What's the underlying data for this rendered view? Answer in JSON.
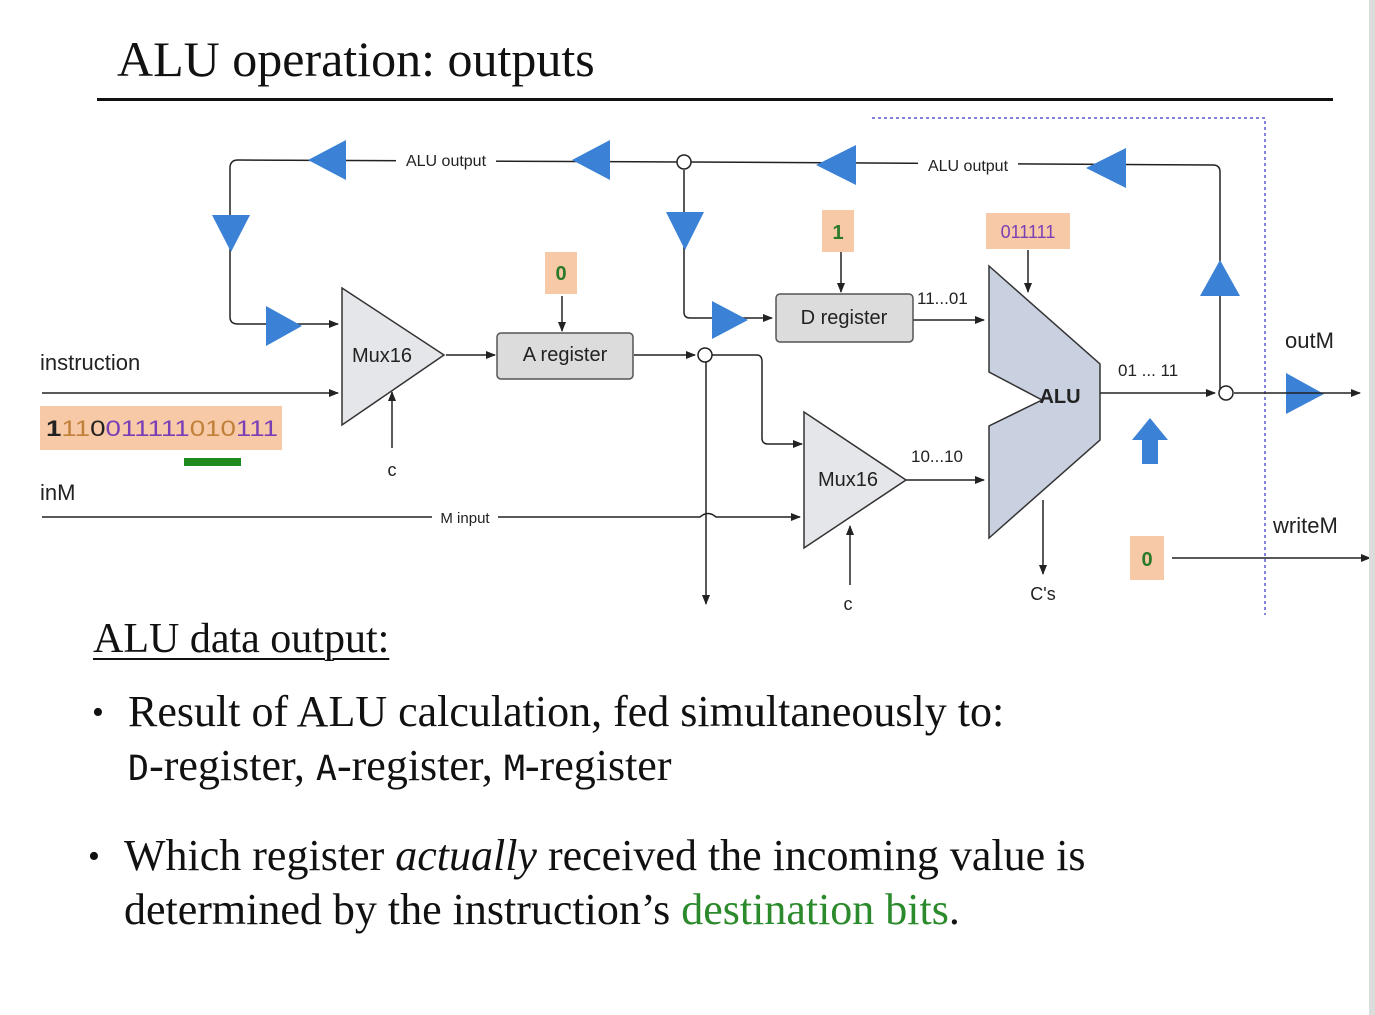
{
  "slide": {
    "title": "ALU operation: outputs"
  },
  "diagram": {
    "labels": {
      "alu_output_left": "ALU output",
      "alu_output_right": "ALU output",
      "m_input": "M input",
      "instruction": "instruction",
      "inM": "inM",
      "outM": "outM",
      "writeM": "writeM",
      "c_mux1": "c",
      "c_mux2": "c",
      "cs": "C's",
      "d_to_alu": "11...01",
      "mux_to_alu": "10...10",
      "alu_out": "01 ... 11"
    },
    "components": {
      "mux1": "Mux16",
      "a_register": "A register",
      "d_register": "D register",
      "mux2": "Mux16",
      "alu": "ALU"
    },
    "values": {
      "a_load": "0",
      "d_load": "1",
      "alu_control": "011111",
      "write_m": "0"
    },
    "instruction_bits": {
      "b1": "1",
      "b2": "11",
      "b3": "0",
      "b4": "011111",
      "b5": "010",
      "b6": "111"
    },
    "colors": {
      "arrow_blue": "#3b82d6",
      "value_box": "#f7c9a6",
      "bit_purple": "#7a3fb5",
      "bit_orange": "#c0803a",
      "dest_bar_green": "#1e8a1e"
    }
  },
  "body": {
    "heading": "ALU data output:",
    "bullet1_line1": "Result of ALU calculation, fed simultaneously to:",
    "bullet1_d": "D",
    "bullet1_d_rest": "-register, ",
    "bullet1_a": "A",
    "bullet1_a_rest": "-register, ",
    "bullet1_m": "M",
    "bullet1_m_rest": "-register",
    "bullet2_pre": "Which register ",
    "bullet2_em": "actually",
    "bullet2_post": " received the incoming value is",
    "bullet2_line2_pre": "determined by the instruction’s ",
    "bullet2_green": "destination bits",
    "bullet2_end": "."
  }
}
